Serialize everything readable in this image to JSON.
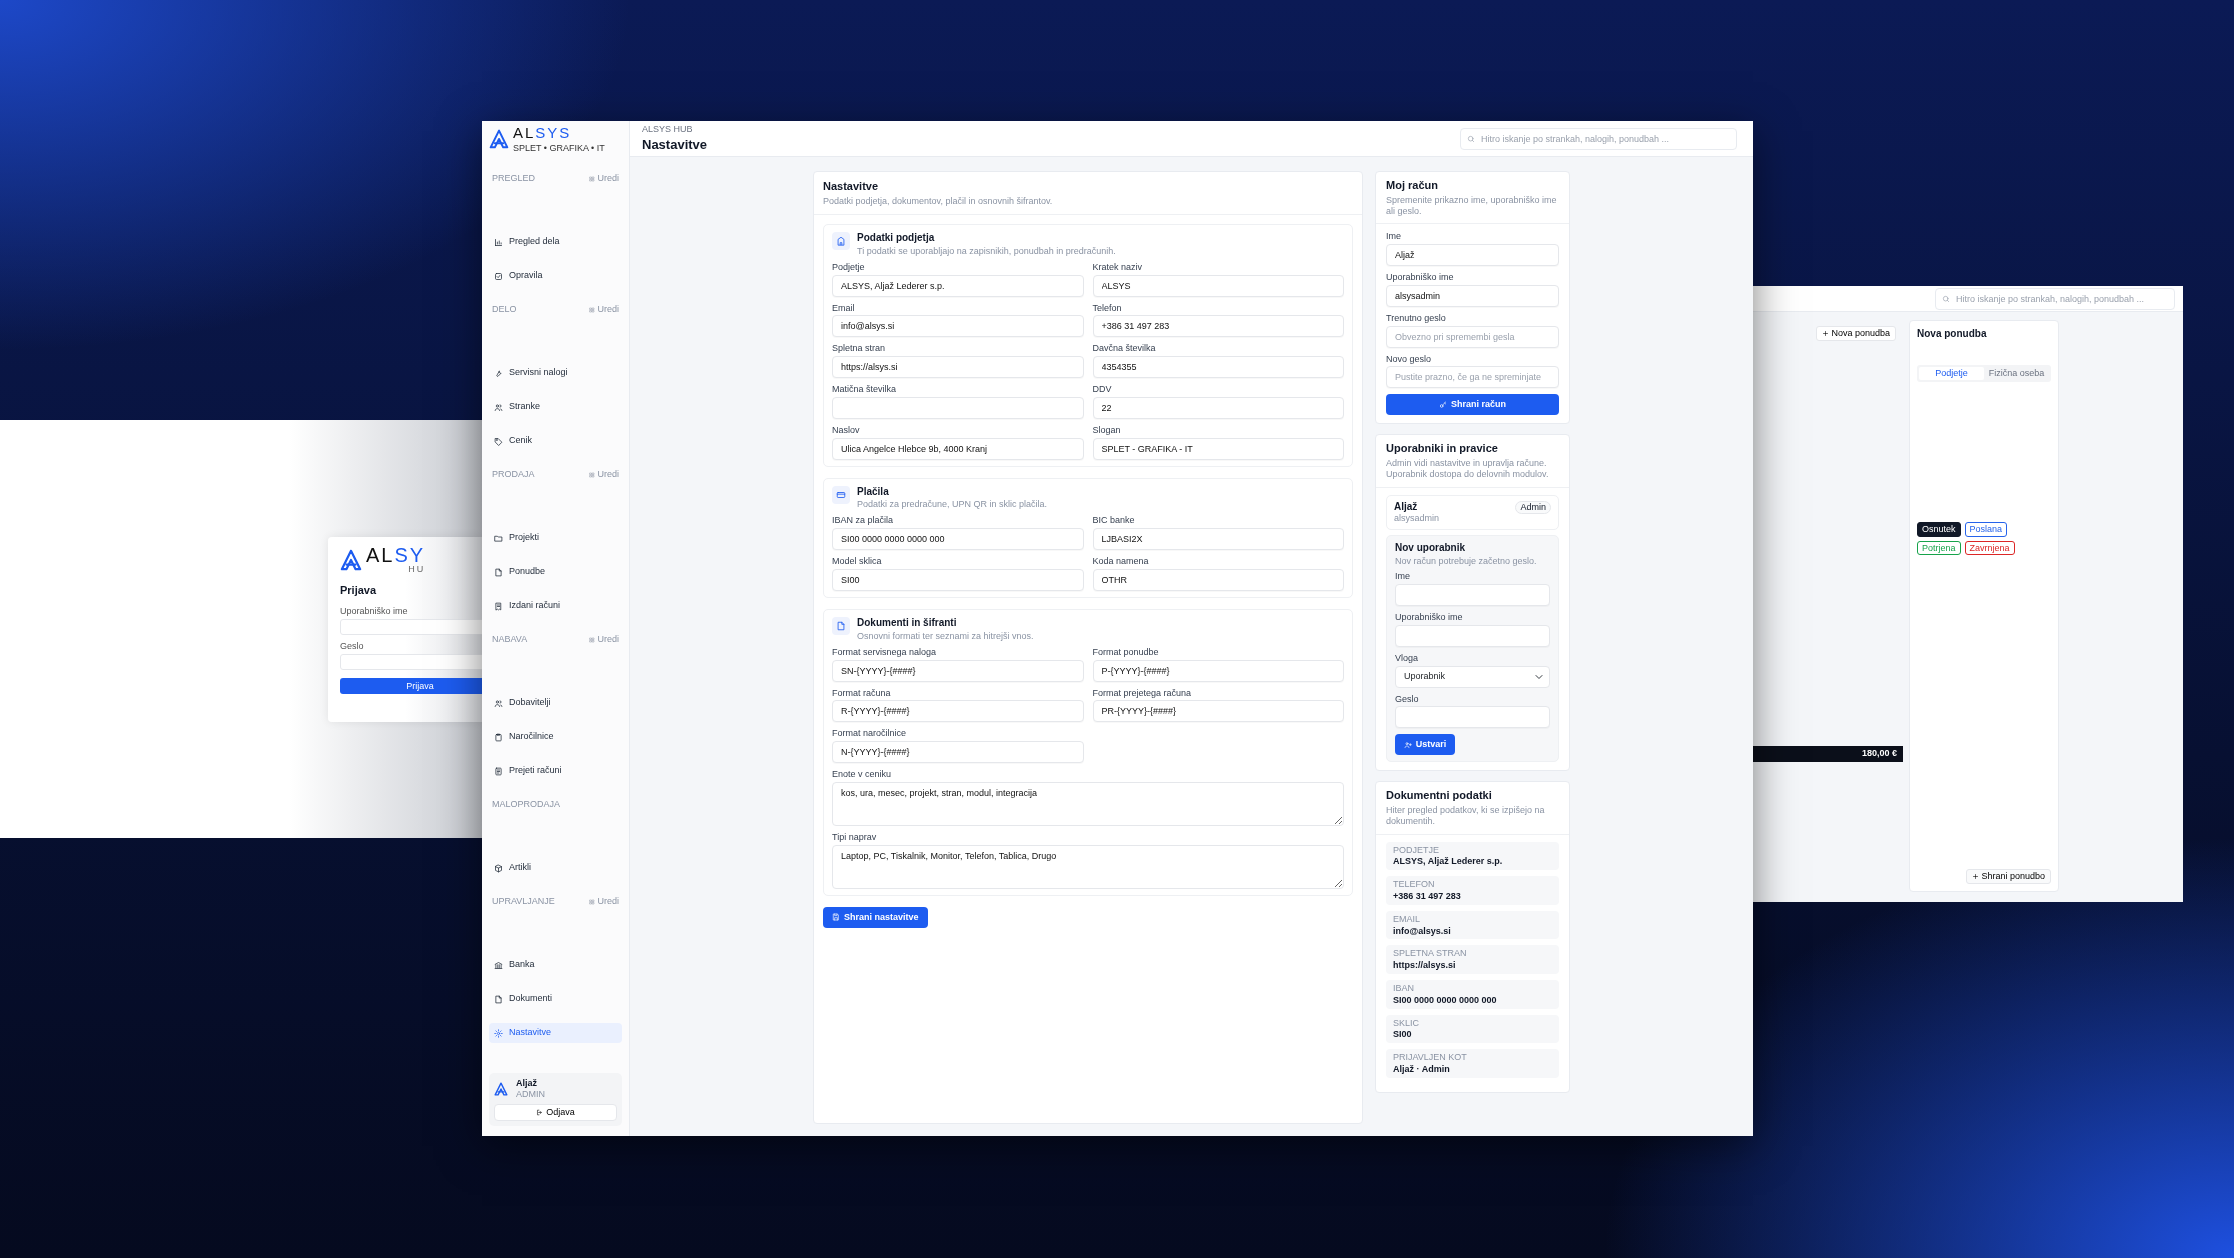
{
  "login_window": {
    "logo_left": "AL",
    "logo_right": "SY",
    "logo_sub": "HU",
    "title": "Prijava",
    "fields": [
      {
        "label": "Uporabniško ime"
      },
      {
        "label": "Geslo"
      }
    ],
    "button": "Prijava"
  },
  "offers_window": {
    "search_placeholder": "Hitro iskanje po strankah, nalogih, ponudbah ...",
    "new_button": "Nova ponudba",
    "total": "180,00 €",
    "panel_title": "Nova ponudba",
    "tabs": [
      {
        "label": "Podjetje",
        "selected": true
      },
      {
        "label": "Fizična oseba",
        "selected": false
      }
    ],
    "statuses": [
      {
        "label": "Osnutek",
        "selected": true,
        "color": "#111827"
      },
      {
        "label": "Poslana",
        "selected": false,
        "color": "#2563eb"
      },
      {
        "label": "Potrjena",
        "selected": false,
        "color": "#16a34a"
      },
      {
        "label": "Zavrnjena",
        "selected": false,
        "color": "#dc2626"
      }
    ],
    "save_button": "Shrani ponudbo"
  },
  "logo": {
    "left": "AL",
    "right": "SYS",
    "tagline": "SPLET • GRAFIKA • IT"
  },
  "sidebar": {
    "sections": [
      {
        "label": "PREGLED",
        "edit": "Uredi",
        "items": [
          {
            "label": "Pregled dela",
            "selected": false
          },
          {
            "label": "Opravila",
            "selected": false
          }
        ]
      },
      {
        "label": "DELO",
        "edit": "Uredi",
        "items": [
          {
            "label": "Servisni nalogi",
            "selected": false
          },
          {
            "label": "Stranke",
            "selected": false
          },
          {
            "label": "Cenik",
            "selected": false
          }
        ]
      },
      {
        "label": "PRODAJA",
        "edit": "Uredi",
        "items": [
          {
            "label": "Projekti",
            "selected": false
          },
          {
            "label": "Ponudbe",
            "selected": false
          },
          {
            "label": "Izdani računi",
            "selected": false
          }
        ]
      },
      {
        "label": "NABAVA",
        "edit": "Uredi",
        "items": [
          {
            "label": "Dobavitelji",
            "selected": false
          },
          {
            "label": "Naročilnice",
            "selected": false
          },
          {
            "label": "Prejeti računi",
            "selected": false
          }
        ]
      },
      {
        "label": "MALOPRODAJA",
        "items": [
          {
            "label": "Artikli",
            "selected": false
          }
        ]
      },
      {
        "label": "UPRAVLJANJE",
        "edit": "Uredi",
        "items": [
          {
            "label": "Banka",
            "selected": false
          },
          {
            "label": "Dokumenti",
            "selected": false
          },
          {
            "label": "Nastavitve",
            "selected": true
          }
        ]
      }
    ],
    "user": {
      "name": "Aljaž",
      "role": "ADMIN",
      "logout": "Odjava"
    }
  },
  "header": {
    "breadcrumb": "ALSYS HUB",
    "title": "Nastavitve",
    "search_placeholder": "Hitro iskanje po strankah, nalogih, ponudbah ..."
  },
  "settings": {
    "title": "Nastavitve",
    "subtitle": "Podatki podjetja, dokumentov, plačil in osnovnih šifrantov.",
    "sections": [
      {
        "title": "Podatki podjetja",
        "subtitle": "Ti podatki se uporabljajo na zapisnikih, ponudbah in predračunih.",
        "fields": [
          {
            "label": "Podjetje",
            "value": "ALSYS, Aljaž Lederer s.p.",
            "kind": "input"
          },
          {
            "label": "Kratek naziv",
            "value": "ALSYS",
            "kind": "input"
          },
          {
            "label": "Email",
            "value": "info@alsys.si",
            "kind": "input"
          },
          {
            "label": "Telefon",
            "value": "+386 31 497 283",
            "kind": "input"
          },
          {
            "label": "Spletna stran",
            "value": "https://alsys.si",
            "kind": "input"
          },
          {
            "label": "Davčna številka",
            "value": "4354355",
            "kind": "input"
          },
          {
            "label": "Matična številka",
            "kind": "input"
          },
          {
            "label": "DDV",
            "value": "22",
            "kind": "input"
          },
          {
            "label": "Naslov",
            "value": "Ulica Angelce Hlebce 9b, 4000 Kranj",
            "kind": "input"
          },
          {
            "label": "Slogan",
            "value": "SPLET - GRAFIKA - IT",
            "kind": "input"
          }
        ]
      },
      {
        "title": "Plačila",
        "subtitle": "Podatki za predračune, UPN QR in sklic plačila.",
        "fields": [
          {
            "label": "IBAN za plačila",
            "value": "SI00 0000 0000 0000 000",
            "kind": "input"
          },
          {
            "label": "BIC banke",
            "value": "LJBASI2X",
            "kind": "input"
          },
          {
            "label": "Model sklica",
            "value": "SI00",
            "kind": "input"
          },
          {
            "label": "Koda namena",
            "value": "OTHR",
            "kind": "input"
          }
        ]
      },
      {
        "title": "Dokumenti in šifranti",
        "subtitle": "Osnovni formati ter seznami za hitrejši vnos.",
        "fields": [
          {
            "label": "Format servisnega naloga",
            "value": "SN-{YYYY}-{####}",
            "kind": "input"
          },
          {
            "label": "Format ponudbe",
            "value": "P-{YYYY}-{####}",
            "kind": "input"
          },
          {
            "label": "Format računa",
            "value": "R-{YYYY}-{####}",
            "kind": "input"
          },
          {
            "label": "Format prejetega računa",
            "value": "PR-{YYYY}-{####}",
            "kind": "input"
          },
          {
            "label": "Format naročilnice",
            "value": "N-{YYYY}-{####}",
            "kind": "input"
          },
          {
            "label": "Enote v ceniku",
            "value": "kos, ura, mesec, projekt, stran, modul, integracija",
            "kind": "textarea"
          },
          {
            "label": "Tipi naprav",
            "value": "Laptop, PC, Tiskalnik, Monitor, Telefon, Tablica, Drugo",
            "kind": "textarea"
          }
        ]
      }
    ],
    "save_button": "Shrani nastavitve"
  },
  "account": {
    "title": "Moj račun",
    "subtitle": "Spremenite prikazno ime, uporabniško ime ali geslo.",
    "fields": [
      {
        "label": "Ime",
        "value": "Aljaž"
      },
      {
        "label": "Uporabniško ime",
        "value": "alsysadmin"
      },
      {
        "label": "Trenutno geslo",
        "placeholder": "Obvezno pri spremembi gesla"
      },
      {
        "label": "Novo geslo",
        "placeholder": "Pustite prazno, če ga ne spreminjate"
      }
    ],
    "save_button": "Shrani račun"
  },
  "users": {
    "title": "Uporabniki in pravice",
    "subtitle": "Admin vidi nastavitve in upravlja račune. Uporabnik dostopa do delovnih modulov.",
    "list": [
      {
        "name": "Aljaž",
        "username": "alsysadmin",
        "role": "Admin"
      }
    ],
    "new_user": {
      "title": "Nov uporabnik",
      "subtitle": "Nov račun potrebuje začetno geslo.",
      "fields": [
        {
          "label": "Ime",
          "kind": "input"
        },
        {
          "label": "Uporabniško ime",
          "kind": "input"
        },
        {
          "label": "Vloga",
          "kind": "select",
          "value": "Uporabnik"
        },
        {
          "label": "Geslo",
          "kind": "input"
        }
      ],
      "button": "Ustvari"
    }
  },
  "doc_data": {
    "title": "Dokumentni podatki",
    "subtitle": "Hiter pregled podatkov, ki se izpišejo na dokumentih.",
    "items": [
      {
        "label": "PODJETJE",
        "value": "ALSYS, Aljaž Lederer s.p."
      },
      {
        "label": "TELEFON",
        "value": "+386 31 497 283"
      },
      {
        "label": "EMAIL",
        "value": "info@alsys.si"
      },
      {
        "label": "SPLETNA STRAN",
        "value": "https://alsys.si"
      },
      {
        "label": "IBAN",
        "value": "SI00 0000 0000 0000 000"
      },
      {
        "label": "SKLIC",
        "value": "SI00"
      },
      {
        "label": "PRIJAVLJEN KOT",
        "value": "Aljaž · Admin"
      }
    ]
  }
}
